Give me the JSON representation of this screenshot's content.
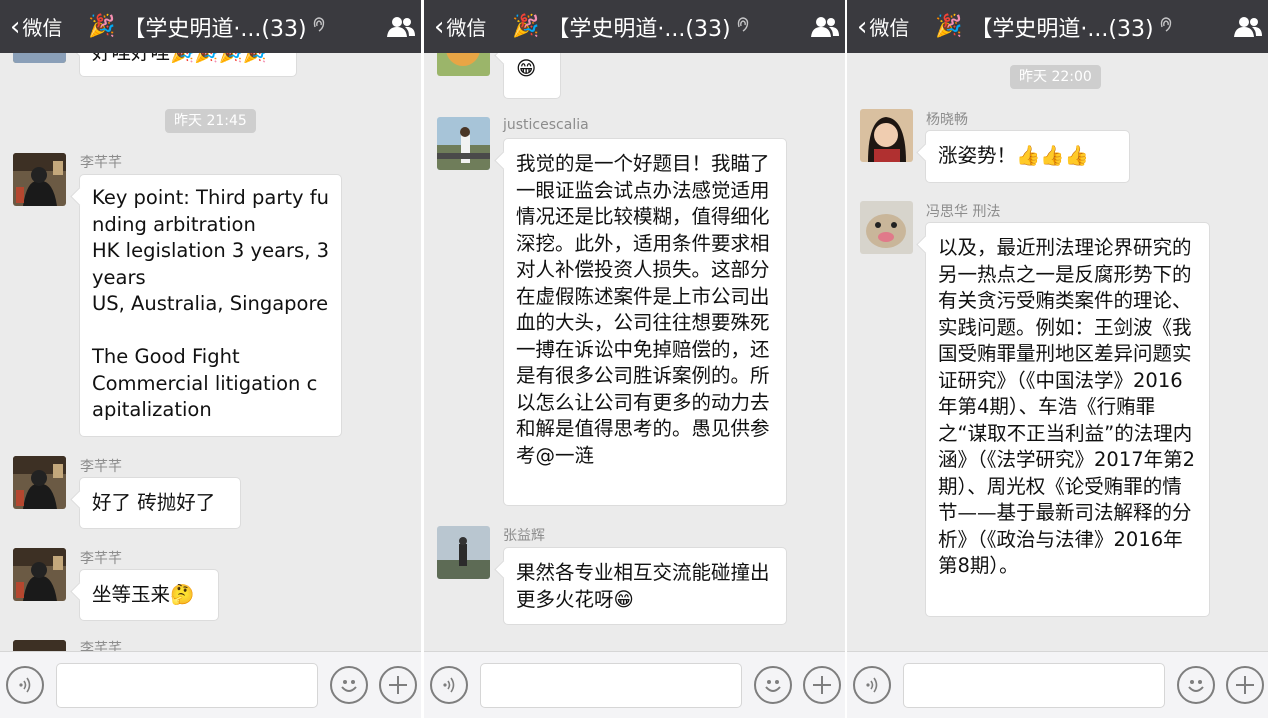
{
  "panels": [
    {
      "header": {
        "back_label": "微信",
        "title": "【学史明道·...(33)"
      },
      "time": "昨天 21:45",
      "messages": [
        {
          "text": "好哇好哇🎉🎉🎉🎉"
        },
        {
          "sender": "李芊芊",
          "text": "Key point: Third party funding arbitration\nHK legislation 3 years, 3 years\nUS, Australia, Singapore\n\nThe Good Fight\nCommercial litigation capitalization"
        },
        {
          "sender": "李芊芊",
          "text": "好了 砖抛好了"
        },
        {
          "sender": "李芊芊",
          "text": "坐等玉来🤔"
        },
        {
          "sender": "李芊芊"
        }
      ]
    },
    {
      "header": {
        "back_label": "微信",
        "title": "【学史明道·...(33)"
      },
      "messages": [
        {
          "text": "😁"
        },
        {
          "sender": "justicescalia",
          "text": "我觉的是一个好题目！我瞄了一眼证监会试点办法感觉适用情况还是比较模糊，值得细化深挖。此外，适用条件要求相对人补偿投资人损失。这部分在虚假陈述案件是上市公司出血的大头，公司往往想要殊死一搏在诉讼中免掉赔偿的，还是有很多公司胜诉案例的。所以怎么让公司有更多的动力去和解是值得思考的。愚见供参考@一涟"
        },
        {
          "sender": "张益辉",
          "text": "果然各专业相互交流能碰撞出更多火花呀😁"
        }
      ]
    },
    {
      "header": {
        "back_label": "微信",
        "title": "【学史明道·...(33)"
      },
      "time": "昨天 22:00",
      "messages": [
        {
          "sender": "杨晓畅",
          "text": "涨姿势！👍👍👍"
        },
        {
          "sender": "冯思华 刑法",
          "text": "以及，最近刑法理论界研究的另一热点之一是反腐形势下的有关贪污受贿类案件的理论、实践问题。例如：王剑波《我国受贿罪量刑地区差异问题实证研究》（《中国法学》2016年第4期）、车浩《行贿罪之“谋取不正当利益”的法理内涵》（《法学研究》2017年第2期）、周光权《论受贿罪的情节——基于最新司法解释的分析》（《政治与法律》2016年第8期）。"
        }
      ]
    }
  ],
  "colors": {
    "header_bg": "#3a3a3f",
    "chat_bg": "#ebebeb",
    "bubble_bg": "#ffffff",
    "time_bg": "#cecece"
  },
  "icons": {
    "back": "chevron-left-icon",
    "people": "group-members-icon",
    "voice": "voice-icon",
    "emoji": "emoji-icon",
    "plus": "plus-icon",
    "mute": "mute-icon",
    "party": "party-popper-icon"
  }
}
